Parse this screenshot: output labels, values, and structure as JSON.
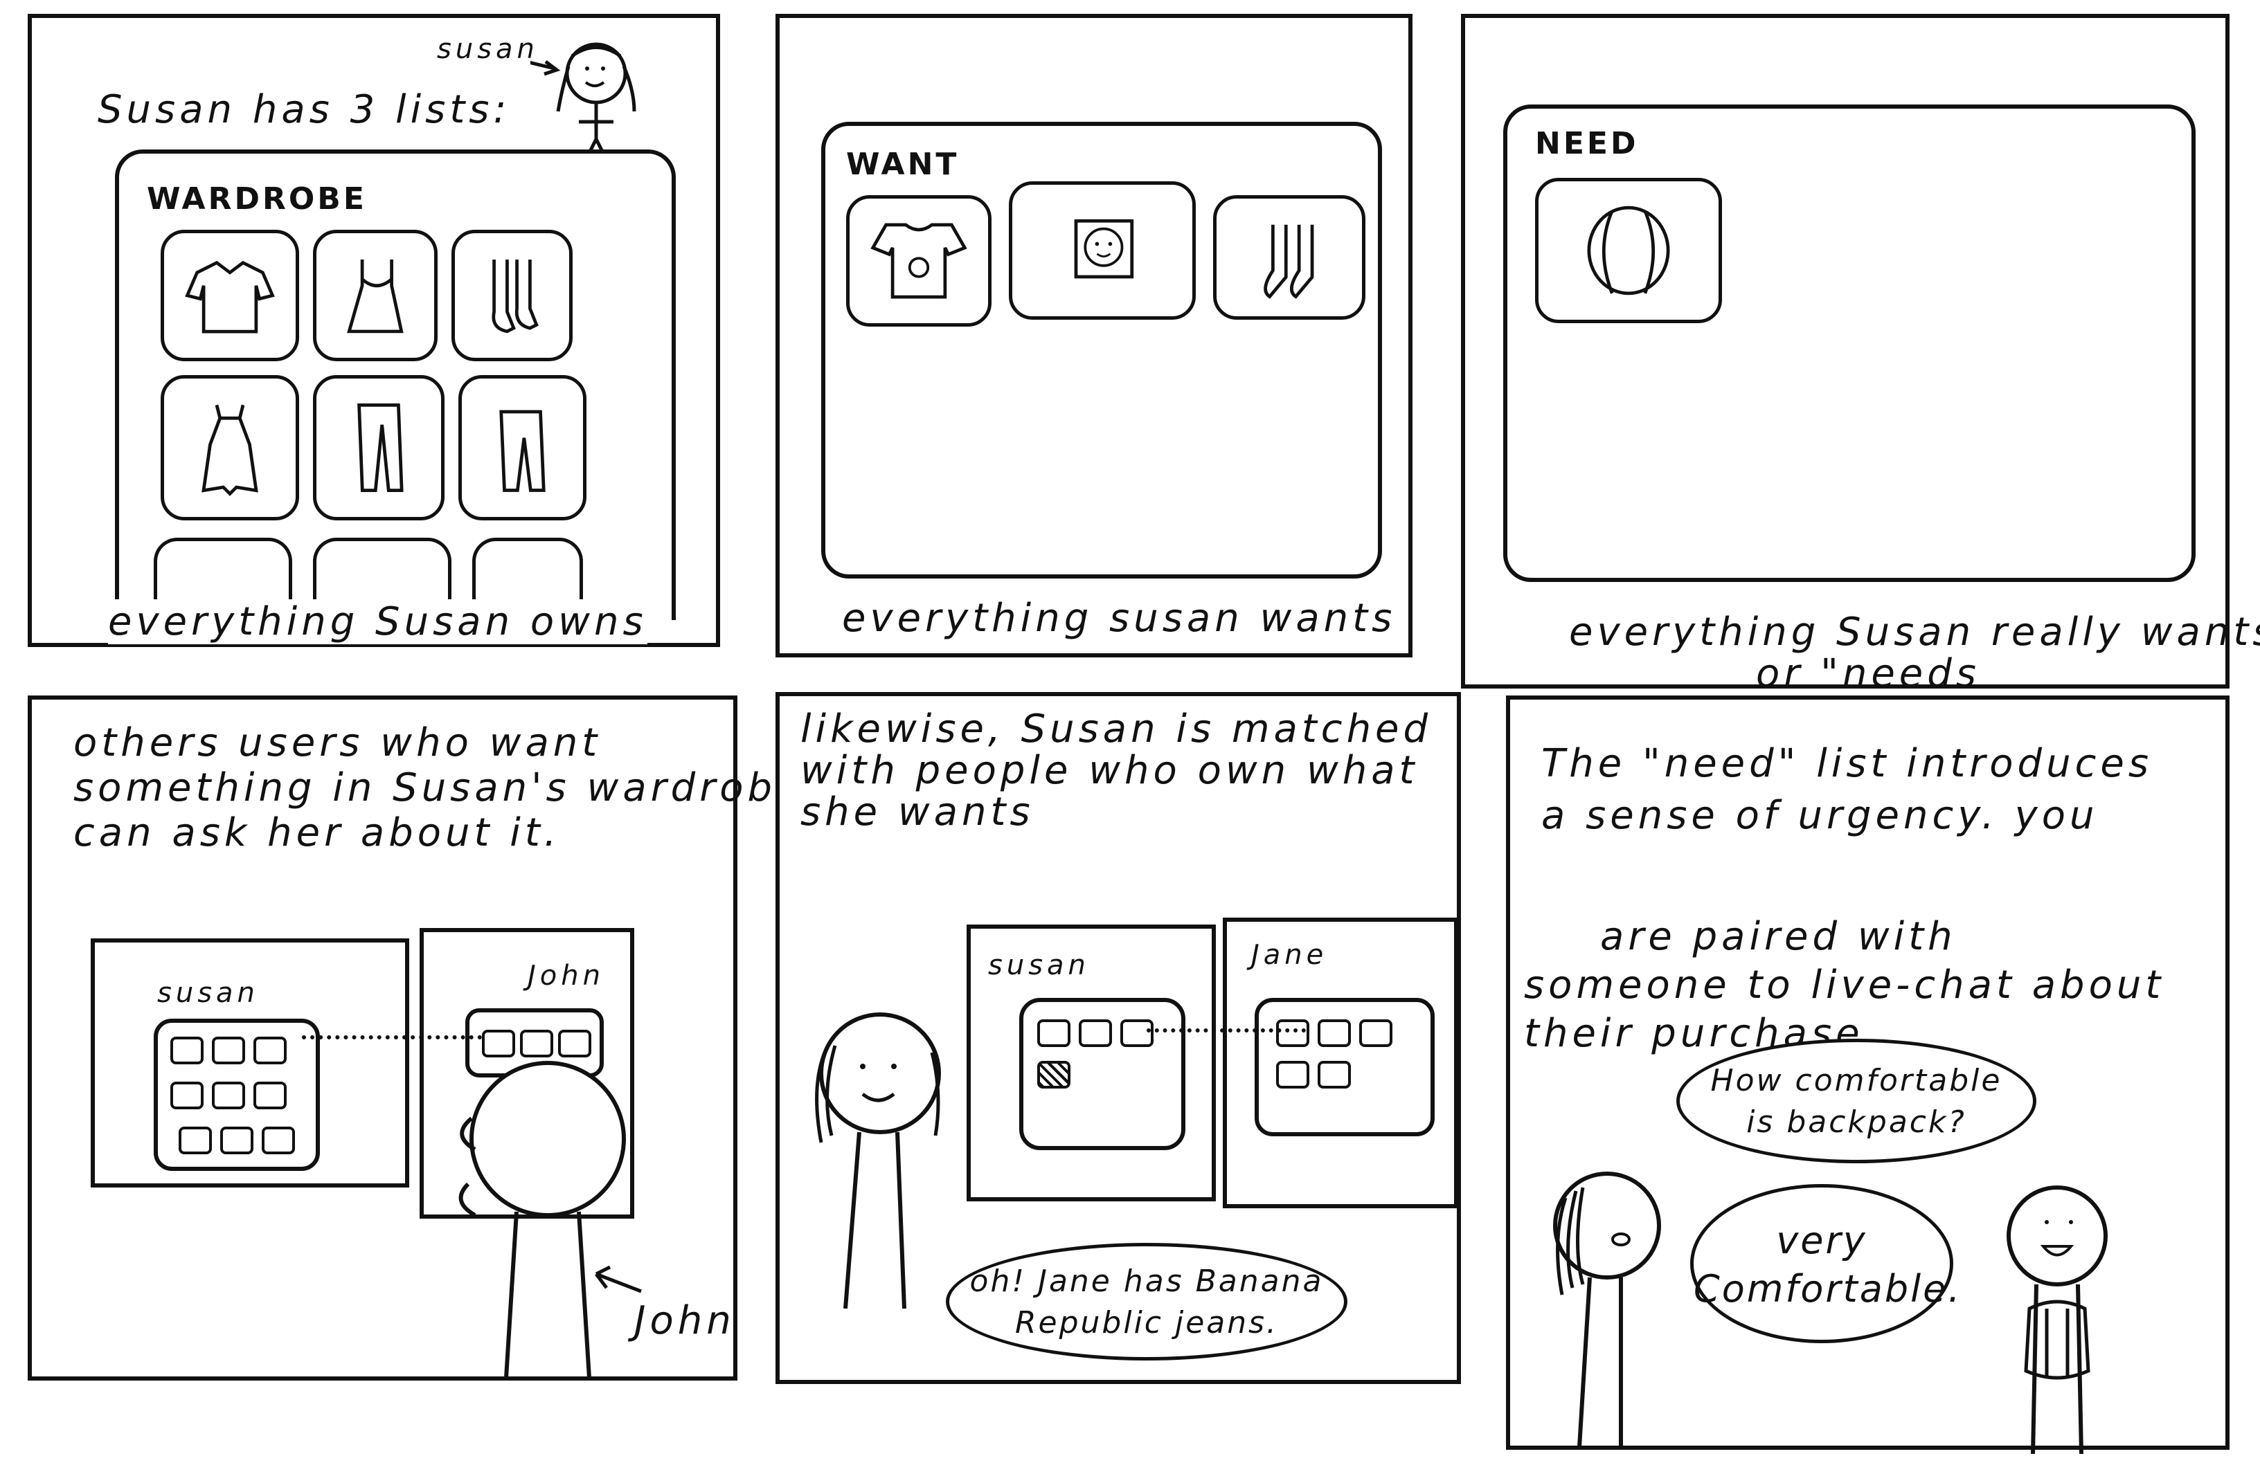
{
  "panel1": {
    "title": "Susan has 3 lists:",
    "susan_label": "susan",
    "wardrobe_label": "WARDROBE",
    "wardrobe_items": [
      "shirt-icon",
      "tank-top-icon",
      "socks-icon",
      "dress-icon",
      "pants-icon",
      "leggings-icon"
    ],
    "caption": "everything Susan owns"
  },
  "panel2": {
    "want_label": "WANT",
    "want_items": [
      "graphic-tee-icon",
      "framed-face-icon",
      "socks-icon"
    ],
    "caption": "everything susan wants"
  },
  "panel3": {
    "need_label": "NEED",
    "need_items": [
      "backpack-icon"
    ],
    "caption_line1": "everything Susan really wants,",
    "caption_line2": "or \"needs"
  },
  "panel4": {
    "text_line1": "others users who want",
    "text_line2": "something in Susan's wardrobe",
    "text_line3": "can ask her about it.",
    "susan_label": "susan",
    "john_label": "John",
    "john_arrow_label": "John"
  },
  "panel5": {
    "text_line1": "likewise, Susan is matched",
    "text_line2": "with people who own what",
    "text_line3": "she wants",
    "susan_label": "susan",
    "jane_label": "Jane",
    "bubble_line1": "oh! Jane has Banana",
    "bubble_line2": "Republic jeans."
  },
  "panel6": {
    "text_line1": "The \"need\" list introduces",
    "text_line2": "a sense of urgency. you",
    "text_line3": "are paired with",
    "text_line4": "someone to live-chat about",
    "text_line5": "their purchase.",
    "bubble1_line1": "How comfortable",
    "bubble1_line2": "is backpack?",
    "bubble2_line1": "very",
    "bubble2_line2": "Comfortable."
  }
}
